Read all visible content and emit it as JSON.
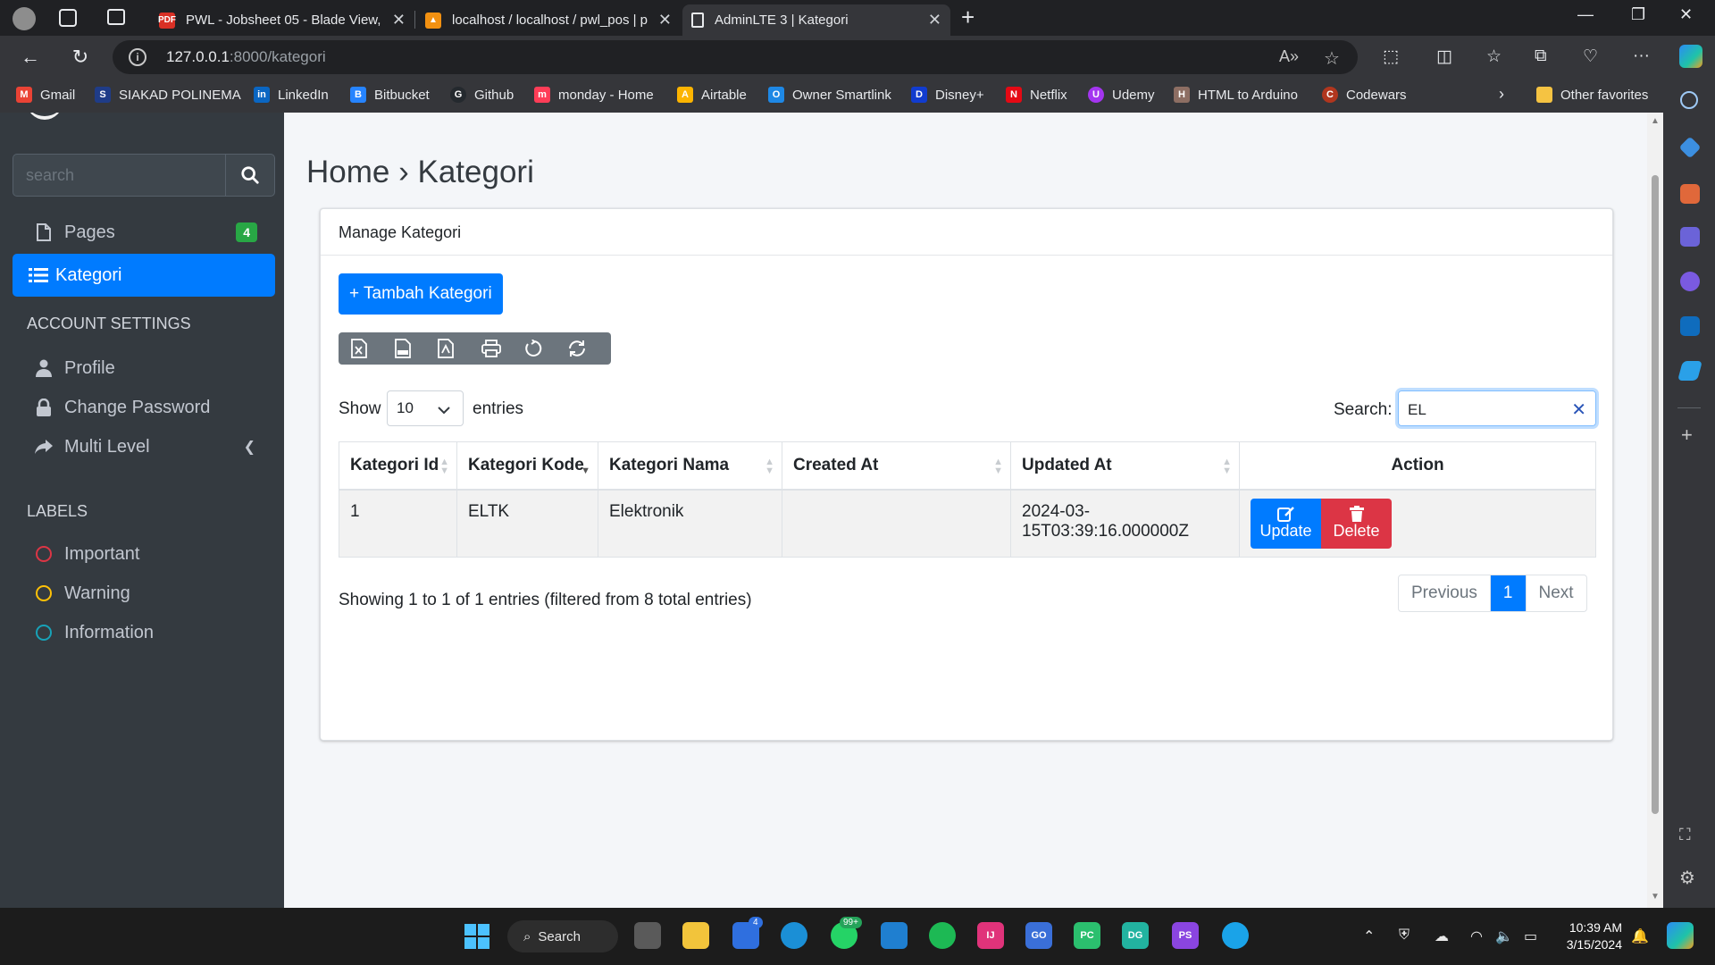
{
  "browser": {
    "tabs": [
      {
        "title": "PWL - Jobsheet 05 - Blade View,",
        "icon": "pdf-icon",
        "active": false
      },
      {
        "title": "localhost / localhost / pwl_pos | p",
        "icon": "phpmyadmin-icon",
        "active": false
      },
      {
        "title": "AdminLTE 3 | Kategori",
        "icon": "page-icon",
        "active": true
      }
    ],
    "url_host": "127.0.0.1",
    "url_path": ":8000/kategori",
    "bookmarks": [
      {
        "label": "Gmail",
        "color": "#ea4335",
        "glyph": "M"
      },
      {
        "label": "SIAKAD POLINEMA",
        "color": "#1f3c88",
        "glyph": "S"
      },
      {
        "label": "LinkedIn",
        "color": "#0a66c2",
        "glyph": "in"
      },
      {
        "label": "Bitbucket",
        "color": "#2684ff",
        "glyph": "B"
      },
      {
        "label": "Github",
        "color": "#24292e",
        "glyph": "G"
      },
      {
        "label": "monday - Home",
        "color": "#ff3d57",
        "glyph": "m"
      },
      {
        "label": "Airtable",
        "color": "#fcb400",
        "glyph": "A"
      },
      {
        "label": "Owner Smartlink",
        "color": "#1e88e5",
        "glyph": "O"
      },
      {
        "label": "Disney+",
        "color": "#113ccf",
        "glyph": "D"
      },
      {
        "label": "Netflix",
        "color": "#e50914",
        "glyph": "N"
      },
      {
        "label": "Udemy",
        "color": "#a435f0",
        "glyph": "U"
      },
      {
        "label": "HTML to Arduino",
        "color": "#8d6e63",
        "glyph": "H"
      },
      {
        "label": "Codewars",
        "color": "#b1361e",
        "glyph": "C"
      }
    ],
    "other_favorites": "Other favorites"
  },
  "sidebar": {
    "search_placeholder": "search",
    "items": [
      {
        "label": "Pages",
        "badge": "4"
      },
      {
        "label": "Kategori"
      }
    ],
    "account_header": "ACCOUNT SETTINGS",
    "account_items": [
      {
        "label": "Profile"
      },
      {
        "label": "Change Password"
      },
      {
        "label": "Multi Level"
      }
    ],
    "labels_header": "LABELS",
    "labels": [
      {
        "label": "Important",
        "color": "#dc3545"
      },
      {
        "label": "Warning",
        "color": "#ffc107"
      },
      {
        "label": "Information",
        "color": "#17a2b8"
      }
    ]
  },
  "content": {
    "breadcrumb_home": "Home",
    "breadcrumb_sep": "›",
    "breadcrumb_current": "Kategori",
    "card_title": "Manage Kategori",
    "add_button": "+ Tambah Kategori",
    "export_buttons": [
      "excel-icon",
      "csv-icon",
      "pdf-icon",
      "print-icon",
      "reset-icon",
      "reload-icon"
    ],
    "show_label": "Show",
    "entries_label": "entries",
    "page_length": "10",
    "search_label": "Search:",
    "search_value": "EL",
    "table": {
      "columns": [
        "Kategori Id",
        "Kategori Kode",
        "Kategori Nama",
        "Created At",
        "Updated At",
        "Action"
      ],
      "rows": [
        {
          "id": "1",
          "kode": "ELTK",
          "nama": "Elektronik",
          "created_at": "",
          "updated_at": "2024-03-15T03:39:16.000000Z"
        }
      ],
      "update_label": "Update",
      "delete_label": "Delete"
    },
    "info": "Showing 1 to 1 of 1 entries (filtered from 8 total entries)",
    "pagination": {
      "previous": "Previous",
      "current": "1",
      "next": "Next"
    }
  },
  "taskbar": {
    "search_label": "Search",
    "time": "10:39 AM",
    "date": "3/15/2024",
    "badges": {
      "todo": "4",
      "whatsapp": "99+"
    }
  }
}
